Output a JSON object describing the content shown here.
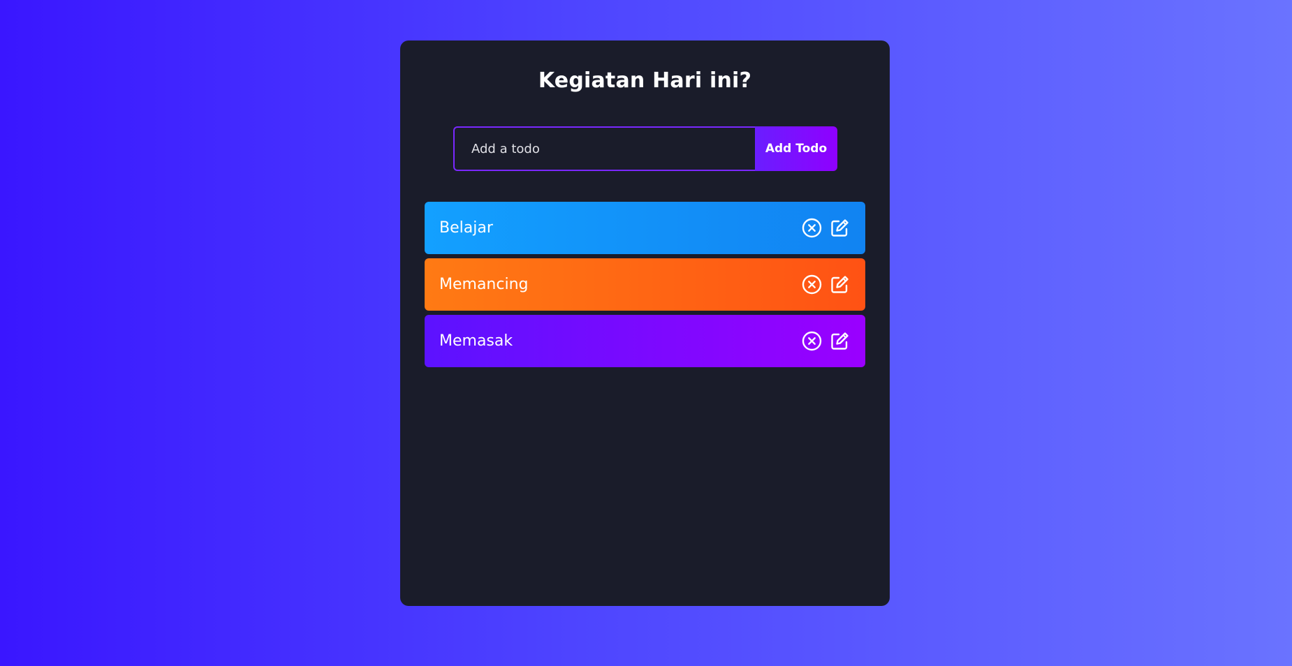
{
  "app": {
    "title": "Kegiatan Hari ini?"
  },
  "form": {
    "input_placeholder": "Add a todo",
    "input_value": "",
    "add_button_label": "Add Todo"
  },
  "todos": [
    {
      "text": "Belajar",
      "color": "#13a0ff",
      "delete_icon": "circle-x-icon",
      "edit_icon": "edit-icon"
    },
    {
      "text": "Memancing",
      "color": "#ff7a14",
      "delete_icon": "circle-x-icon",
      "edit_icon": "edit-icon"
    },
    {
      "text": "Memasak",
      "color": "#5c12ff",
      "delete_icon": "circle-x-icon",
      "edit_icon": "edit-icon"
    }
  ],
  "colors": {
    "background_start": "#3a16ff",
    "background_end": "#6a73ff",
    "panel": "#1a1c2a",
    "accent": "#8f00ff"
  }
}
